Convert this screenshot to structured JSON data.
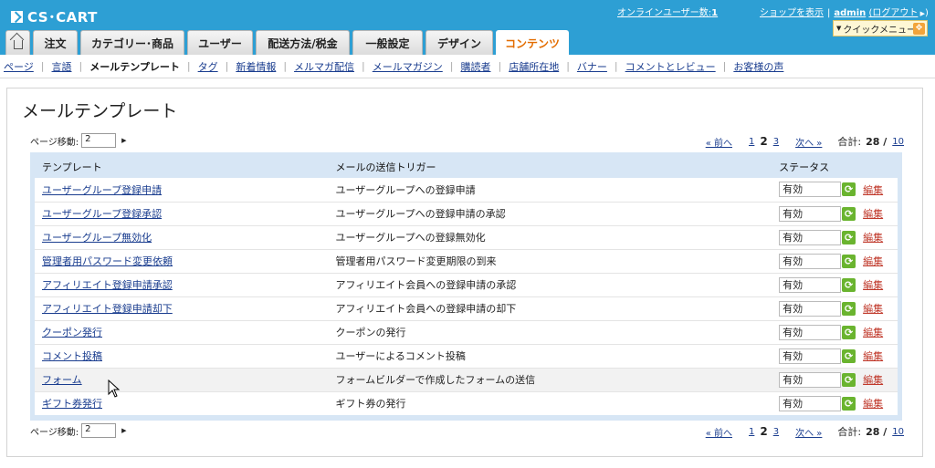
{
  "header": {
    "logo_text": "CS･CART",
    "online_label": "オンラインユーザー数:",
    "online_count": "1",
    "shop_link": "ショップを表示",
    "admin_user": "admin",
    "logout_link": "(ログアウト",
    "logout_suffix": ")",
    "quick_menu": "クイックメニュー"
  },
  "tabs": [
    {
      "label": "",
      "icon": "home-icon"
    },
    {
      "label": "注文"
    },
    {
      "label": "カテゴリー･商品"
    },
    {
      "label": "ユーザー"
    },
    {
      "label": "配送方法/税金"
    },
    {
      "label": "一般設定"
    },
    {
      "label": "デザイン"
    },
    {
      "label": "コンテンツ",
      "active": true
    }
  ],
  "subnav": [
    {
      "label": "ページ"
    },
    {
      "label": "言語"
    },
    {
      "label": "メールテンプレート",
      "current": true
    },
    {
      "label": "タグ"
    },
    {
      "label": "新着情報"
    },
    {
      "label": "メルマガ配信"
    },
    {
      "label": "メールマガジン"
    },
    {
      "label": "購読者"
    },
    {
      "label": "店舗所在地"
    },
    {
      "label": "バナー"
    },
    {
      "label": "コメントとレビュー"
    },
    {
      "label": "お客様の声"
    }
  ],
  "page": {
    "title": "メールテンプレート"
  },
  "pagination": {
    "jump_label": "ページ移動:",
    "jump_value": "2",
    "prev": "« 前へ",
    "page1": "1",
    "page2": "2",
    "page3": "3",
    "next": "次へ »",
    "total_label": "合計:",
    "total": "28 /",
    "per_page": "10"
  },
  "table": {
    "headers": {
      "template": "テンプレート",
      "trigger": "メールの送信トリガー",
      "status": "ステータス"
    },
    "edit_label": "編集",
    "rows": [
      {
        "template": "ユーザーグループ登録申請",
        "trigger": "ユーザーグループへの登録申請",
        "status": "有効"
      },
      {
        "template": "ユーザーグループ登録承認",
        "trigger": "ユーザーグループへの登録申請の承認",
        "status": "有効"
      },
      {
        "template": "ユーザーグループ無効化",
        "trigger": "ユーザーグループへの登録無効化",
        "status": "有効"
      },
      {
        "template": "管理者用パスワード変更依頼",
        "trigger": "管理者用パスワード変更期限の到来",
        "status": "有効"
      },
      {
        "template": "アフィリエイト登録申請承認",
        "trigger": "アフィリエイト会員への登録申請の承認",
        "status": "有効"
      },
      {
        "template": "アフィリエイト登録申請却下",
        "trigger": "アフィリエイト会員への登録申請の却下",
        "status": "有効"
      },
      {
        "template": "クーポン発行",
        "trigger": "クーポンの発行",
        "status": "有効"
      },
      {
        "template": "コメント投稿",
        "trigger": "ユーザーによるコメント投稿",
        "status": "有効"
      },
      {
        "template": "フォーム",
        "trigger": "フォームビルダーで作成したフォームの送信",
        "status": "有効"
      },
      {
        "template": "ギフト券発行",
        "trigger": "ギフト券の発行",
        "status": "有効"
      }
    ]
  }
}
